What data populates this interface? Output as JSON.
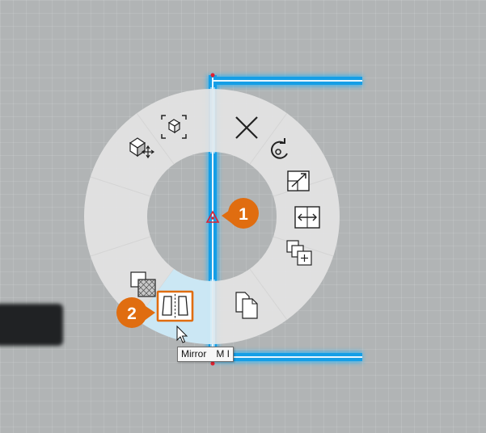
{
  "radial_menu": {
    "items": [
      {
        "id": "frame-selection",
        "icon": "frame-cube-icon"
      },
      {
        "id": "delete",
        "icon": "close-x-icon"
      },
      {
        "id": "rotate",
        "icon": "rotate-icon"
      },
      {
        "id": "scale",
        "icon": "scale-arrow-icon"
      },
      {
        "id": "stretch",
        "icon": "stretch-icon"
      },
      {
        "id": "copy-array",
        "icon": "copy-plus-icon"
      },
      {
        "id": "paste",
        "icon": "paste-documents-icon"
      },
      {
        "id": "mirror",
        "icon": "mirror-icon",
        "highlighted": true
      },
      {
        "id": "hatch",
        "icon": "hatch-icon"
      },
      {
        "id": "move",
        "icon": "move-cube-icon"
      }
    ]
  },
  "tooltip": {
    "label": "Mirror",
    "shortcut": "M I"
  },
  "callouts": [
    {
      "number": "1"
    },
    {
      "number": "2"
    }
  ],
  "colors": {
    "canvas": "#b1b4b5",
    "ring": "#e2e2e2",
    "selection_glow": "#1aa9ef",
    "callout": "#e06d10",
    "anchor_marker": "#e0202f",
    "highlight_segment": "#c9e7f4"
  }
}
